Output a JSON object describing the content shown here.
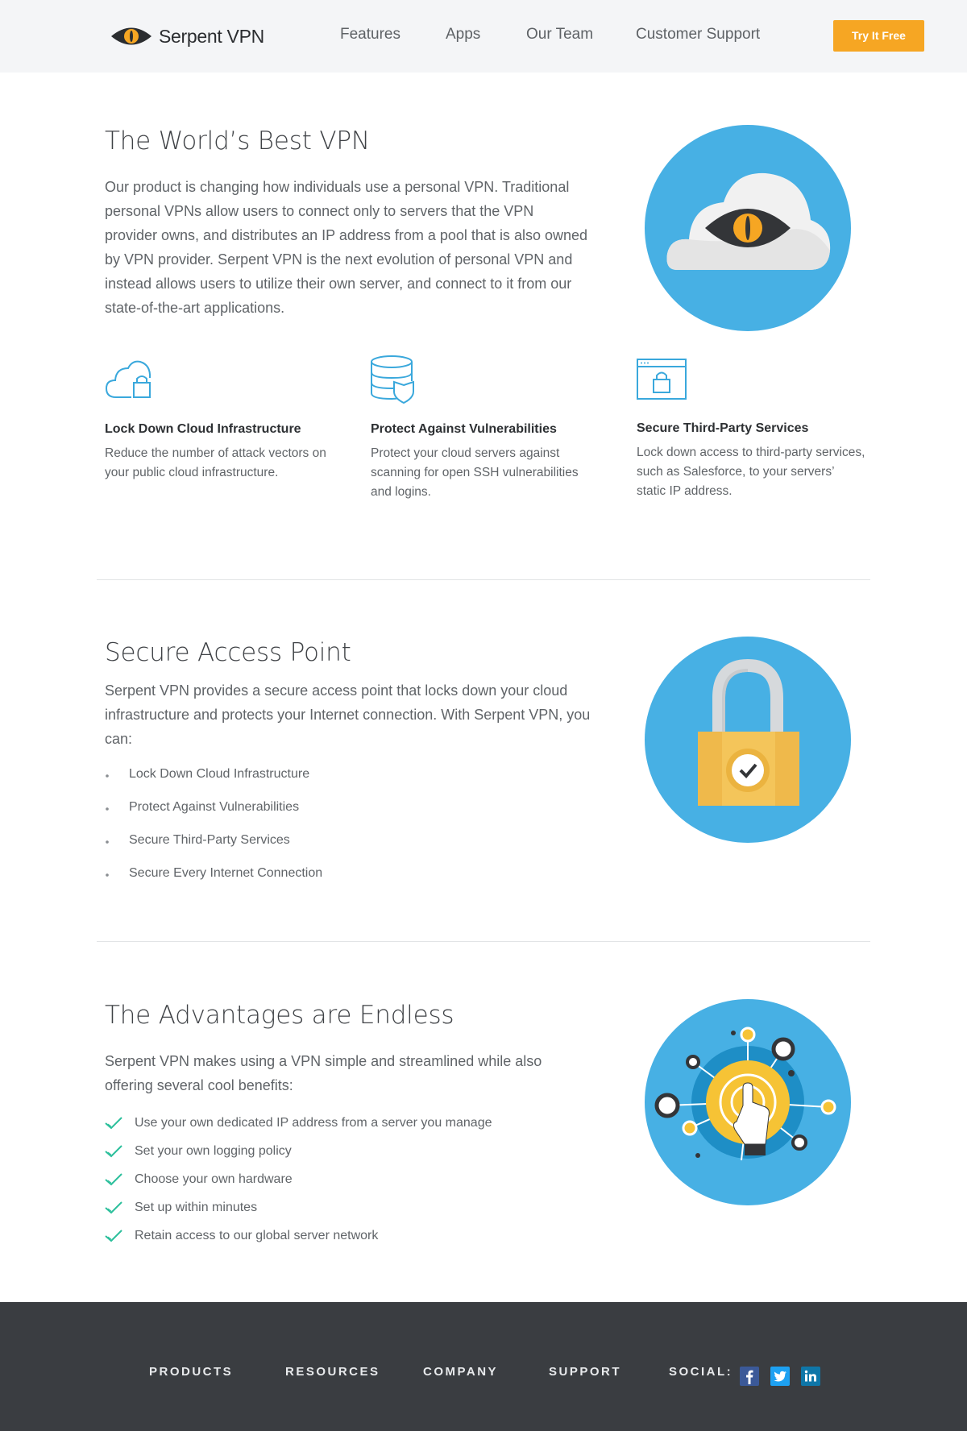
{
  "header": {
    "logo_text": "Serpent VPN",
    "nav": [
      "Features",
      "Apps",
      "Our Team",
      "Customer Support"
    ],
    "cta_label": "Try It Free"
  },
  "section1": {
    "title": "The World’s Best VPN",
    "lead": "Our product is changing how individuals use a personal VPN. Traditional personal VPNs allow users to connect only to servers that the VPN provider owns, and distributes an IP address from a pool that is also owned by VPN provider. Serpent VPN is the next evolution of personal VPN and instead allows users to utilize their own server, and connect to it from our state-of-the-art applications.",
    "features": [
      {
        "title": "Lock Down Cloud Infrastructure",
        "text": "Reduce the number of attack vectors on your public cloud infrastructure.",
        "icon": "cloud-lock-icon"
      },
      {
        "title": "Protect Against Vulnerabilities",
        "text": "Protect your cloud servers against scanning for open SSH vulnerabilities and logins.",
        "icon": "database-shield-icon"
      },
      {
        "title": "Secure Third-Party Services",
        "text": "Lock down access to third-party services, such as Salesforce, to your servers’ static IP address.",
        "icon": "browser-lock-icon"
      }
    ]
  },
  "section2": {
    "title": "Secure Access Point",
    "lead": "Serpent VPN provides a secure access point that locks down your cloud infrastructure and protects your Internet connection. With Serpent VPN, you can:",
    "items": [
      "Lock Down Cloud Infrastructure",
      "Protect Against Vulnerabilities",
      "Secure Third-Party Services",
      "Secure Every Internet Connection"
    ]
  },
  "section3": {
    "title": "The Advantages are Endless",
    "lead": "Serpent VPN makes using a VPN simple and streamlined while also offering several cool benefits:",
    "items": [
      "Use your own dedicated IP address from a server you manage",
      "Set your own logging policy",
      "Choose your own hardware",
      "Set up within minutes",
      "Retain access to our global server network"
    ]
  },
  "footer": {
    "links": [
      "PRODUCTS",
      "RESOURCES",
      "COMPANY",
      "SUPPORT"
    ],
    "social_label": "SOCIAL:",
    "social": [
      {
        "name": "facebook-icon",
        "glyph": "f",
        "color": "#3b5998"
      },
      {
        "name": "twitter-icon",
        "glyph": "t",
        "color": "#1da1f2"
      },
      {
        "name": "linkedin-icon",
        "glyph": "in",
        "color": "#0e76a8"
      }
    ]
  },
  "colors": {
    "accent": "#f6a623",
    "circle": "#47b0e4",
    "footer_bg": "#3a3d41",
    "check": "#2bbf9b",
    "icon_line": "#3aa8dc"
  }
}
